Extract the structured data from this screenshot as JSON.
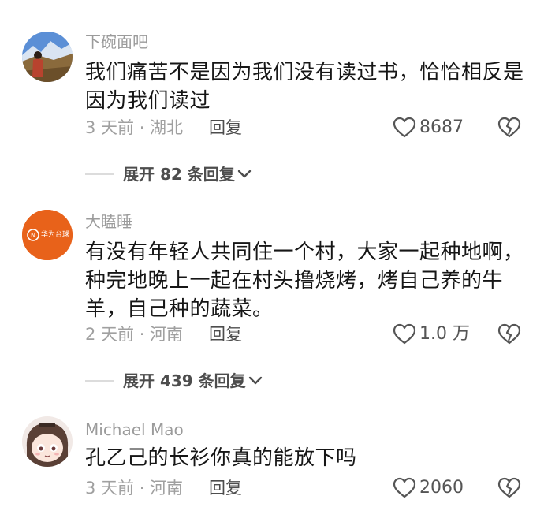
{
  "comments": [
    {
      "username": "下碗面吧",
      "content": "我们痛苦不是因为我们没有读过书，恰恰相反是因为我们读过",
      "time": "3 天前 · 湖北",
      "reply_label": "回复",
      "likes": "8687",
      "expand_label": "展开 82 条回复"
    },
    {
      "username": "大瞌睡",
      "content": "有没有年轻人共同住一个村，大家一起种地啊，种完地晚上一起在村头撸烧烤，烤自己养的牛羊，自己种的蔬菜。",
      "time": "2 天前 · 河南",
      "reply_label": "回复",
      "likes": "1.0 万",
      "expand_label": "展开 439 条回复"
    },
    {
      "username": "Michael Mao",
      "content": "孔乙己的长衫你真的能放下吗",
      "time": "3 天前 · 河南",
      "reply_label": "回复",
      "likes": "2060"
    }
  ],
  "avatar2_text": "华为台球",
  "colors": {
    "avatar2_bg": "#e8621a",
    "text": "#161616",
    "meta": "#a0a0a0"
  }
}
